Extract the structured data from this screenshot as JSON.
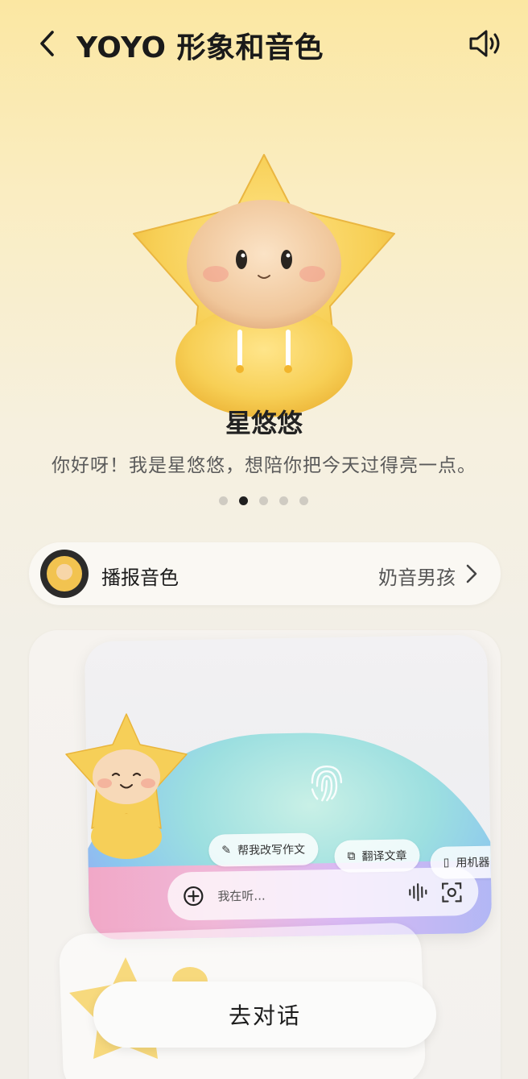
{
  "header": {
    "title": "YOYO 形象和音色",
    "back_icon": "back-arrow-icon",
    "speaker_icon": "speaker-icon"
  },
  "character": {
    "name": "星悠悠",
    "greeting": "你好呀！我是星悠悠，想陪你把今天过得亮一点。"
  },
  "pager": {
    "count": 5,
    "active_index": 1
  },
  "voice": {
    "label": "播报音色",
    "value": "奶音男孩"
  },
  "preview": {
    "chips": [
      "帮我改写作文",
      "翻译文章",
      "用机器"
    ],
    "input_placeholder": "我在听..."
  },
  "actions": {
    "talk_label": "去对话"
  },
  "colors": {
    "accent_yellow": "#f2c350",
    "text_dark": "#1d1d1d",
    "dot_active": "#1f1f1f",
    "dot_inactive": "#cfcbc2"
  }
}
